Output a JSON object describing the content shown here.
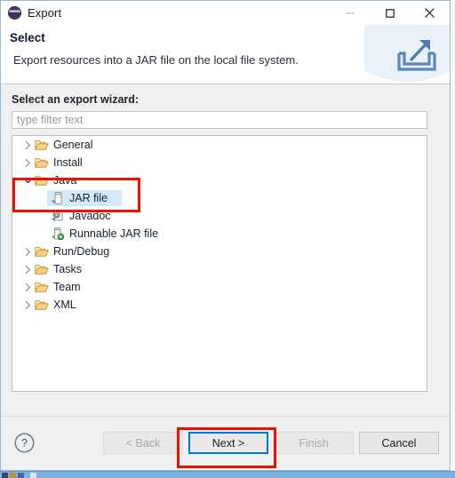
{
  "window": {
    "title": "Export",
    "icon": "eclipse-icon",
    "controls": {
      "minimize": "minimize-icon",
      "maximize": "maximize-icon",
      "close": "close-icon"
    }
  },
  "header": {
    "title": "Select",
    "description": "Export resources into a JAR file on the local file system.",
    "banner_icon": "export-arrow-icon"
  },
  "main": {
    "field_label": "Select an export wizard:",
    "filter": {
      "value": "",
      "placeholder": "type filter text"
    },
    "tree": [
      {
        "label": "General",
        "level": 0,
        "icon": "folder-icon",
        "expander": "collapsed",
        "selected": false
      },
      {
        "label": "Install",
        "level": 0,
        "icon": "folder-icon",
        "expander": "collapsed",
        "selected": false
      },
      {
        "label": "Java",
        "level": 0,
        "icon": "folder-icon",
        "expander": "expanded",
        "selected": false
      },
      {
        "label": "JAR file",
        "level": 1,
        "icon": "jar-file-icon",
        "expander": "none",
        "selected": true
      },
      {
        "label": "Javadoc",
        "level": 1,
        "icon": "javadoc-icon",
        "expander": "none",
        "selected": false
      },
      {
        "label": "Runnable JAR file",
        "level": 1,
        "icon": "runnable-jar-icon",
        "expander": "none",
        "selected": false
      },
      {
        "label": "Run/Debug",
        "level": 0,
        "icon": "folder-icon",
        "expander": "collapsed",
        "selected": false
      },
      {
        "label": "Tasks",
        "level": 0,
        "icon": "folder-icon",
        "expander": "collapsed",
        "selected": false
      },
      {
        "label": "Team",
        "level": 0,
        "icon": "folder-icon",
        "expander": "collapsed",
        "selected": false
      },
      {
        "label": "XML",
        "level": 0,
        "icon": "folder-icon",
        "expander": "collapsed",
        "selected": false
      }
    ]
  },
  "footer": {
    "help_icon": "help-question-icon",
    "back_label": "< Back",
    "next_label": "Next >",
    "finish_label": "Finish",
    "cancel_label": "Cancel"
  },
  "annotations": [
    {
      "name": "java-jar-highlight",
      "color": "#f01000"
    },
    {
      "name": "next-button-highlight",
      "color": "#f01000"
    }
  ],
  "colors": {
    "accent_focus": "#0078d7",
    "annotation": "#f01000",
    "selection": "#d5eaf9",
    "dialog_bg": "#f0f0f0",
    "folder": "#f5c96a"
  }
}
